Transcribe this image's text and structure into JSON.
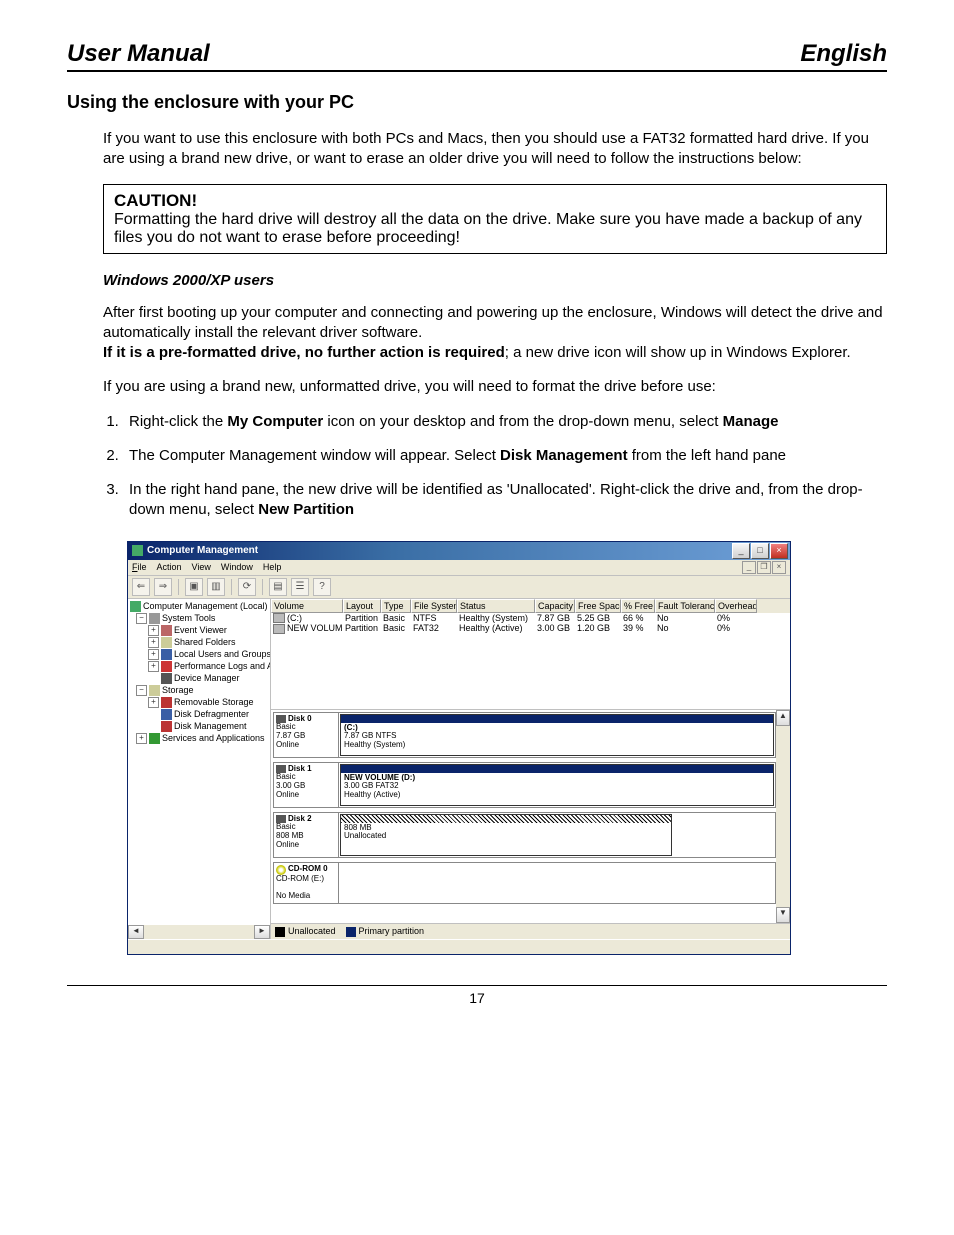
{
  "header": {
    "left": "User Manual",
    "right": "English"
  },
  "section_title": "Using the enclosure with your PC",
  "intro": "If you want to use this enclosure with both PCs and Macs, then you should use a FAT32 formatted hard drive. If you are using a brand new drive, or want to erase an older drive you will need to follow the instructions below:",
  "caution": {
    "title": "CAUTION!",
    "body": "Formatting the hard drive will destroy all the data on the drive. Make sure you have made a backup of any files you do not want to erase before proceeding!"
  },
  "subhead": "Windows 2000/XP users",
  "para1a": "After first booting up your computer and connecting and powering up the enclosure, Windows will detect the drive and automatically install the relevant driver software.",
  "para1b_prefix": "If it is a pre-formatted drive, no further action is required",
  "para1b_suffix": "; a new drive icon will show up in Windows Explorer.",
  "para2": "If you are using a brand new, unformatted drive, you will need to format the drive before use:",
  "steps": {
    "s1a": "Right-click the ",
    "s1b": "My Computer",
    "s1c": " icon on your desktop and from the drop-down menu, select ",
    "s1d": "Manage",
    "s2a": "The Computer Management window will appear. Select ",
    "s2b": "Disk Management",
    "s2c": " from the left hand pane",
    "s3a": "In the right hand pane, the new drive will be identified as 'Unallocated'. Right-click the drive and, from the drop-down menu, select ",
    "s3b": "New Partition"
  },
  "page_number": "17",
  "dm": {
    "title": "Computer Management",
    "menu": {
      "file": "File",
      "action": "Action",
      "view": "View",
      "window": "Window",
      "help": "Help"
    },
    "tree": {
      "root": "Computer Management (Local)",
      "systools": "System Tools",
      "ev": "Event Viewer",
      "sf": "Shared Folders",
      "lu": "Local Users and Groups",
      "pl": "Performance Logs and Alerts",
      "dm": "Device Manager",
      "storage": "Storage",
      "rs": "Removable Storage",
      "dd": "Disk Defragmenter",
      "dmg": "Disk Management",
      "sa": "Services and Applications"
    },
    "columns": [
      "Volume",
      "Layout",
      "Type",
      "File System",
      "Status",
      "Capacity",
      "Free Space",
      "% Free",
      "Fault Tolerance",
      "Overhead"
    ],
    "rows": [
      {
        "vol": "(C:)",
        "layout": "Partition",
        "type": "Basic",
        "fs": "NTFS",
        "status": "Healthy (System)",
        "cap": "7.87 GB",
        "free": "5.25 GB",
        "pct": "66 %",
        "ft": "No",
        "ov": "0%"
      },
      {
        "vol": "NEW VOLUME (D:)",
        "layout": "Partition",
        "type": "Basic",
        "fs": "FAT32",
        "status": "Healthy (Active)",
        "cap": "3.00 GB",
        "free": "1.20 GB",
        "pct": "39 %",
        "ft": "No",
        "ov": "0%"
      }
    ],
    "disks": {
      "d0": {
        "title": "Disk 0",
        "l1": "Basic",
        "l2": "7.87 GB",
        "l3": "Online",
        "vol": "(C:)",
        "vinfo1": "7.87 GB NTFS",
        "vinfo2": "Healthy (System)"
      },
      "d1": {
        "title": "Disk 1",
        "l1": "Basic",
        "l2": "3.00 GB",
        "l3": "Online",
        "vol": "NEW VOLUME (D:)",
        "vinfo1": "3.00 GB FAT32",
        "vinfo2": "Healthy (Active)"
      },
      "d2": {
        "title": "Disk 2",
        "l1": "Basic",
        "l2": "808 MB",
        "l3": "Online",
        "vinfo1": "808 MB",
        "vinfo2": "Unallocated"
      },
      "cd": {
        "title": "CD-ROM 0",
        "l1": "CD-ROM (E:)",
        "l2": "No Media"
      }
    },
    "legend": {
      "unalloc": "Unallocated",
      "primary": "Primary partition"
    }
  }
}
